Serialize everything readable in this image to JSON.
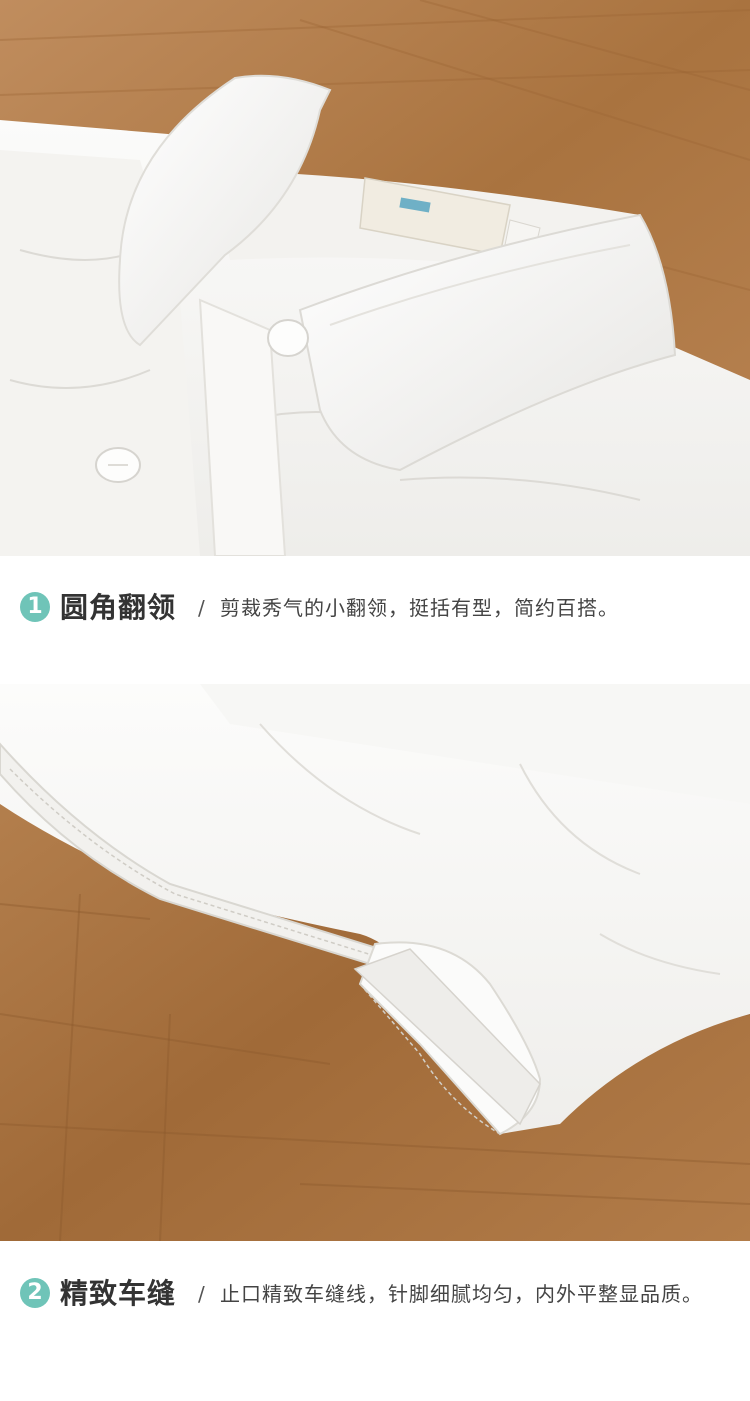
{
  "features": [
    {
      "number": "1",
      "title": "圆角翻领",
      "separator": "/",
      "description": "剪裁秀气的小翻领，挺括有型，简约百搭。"
    },
    {
      "number": "2",
      "title": "精致车缝",
      "separator": "/",
      "description": "止口精致车缝线，针脚细腻均匀，内外平整显品质。"
    }
  ],
  "colors": {
    "accent": "#6fc4b8",
    "wood": "#b07a4c",
    "fabric": "#f7f6f3"
  },
  "icons": [
    "circled-number-1-icon",
    "circled-number-2-icon"
  ]
}
